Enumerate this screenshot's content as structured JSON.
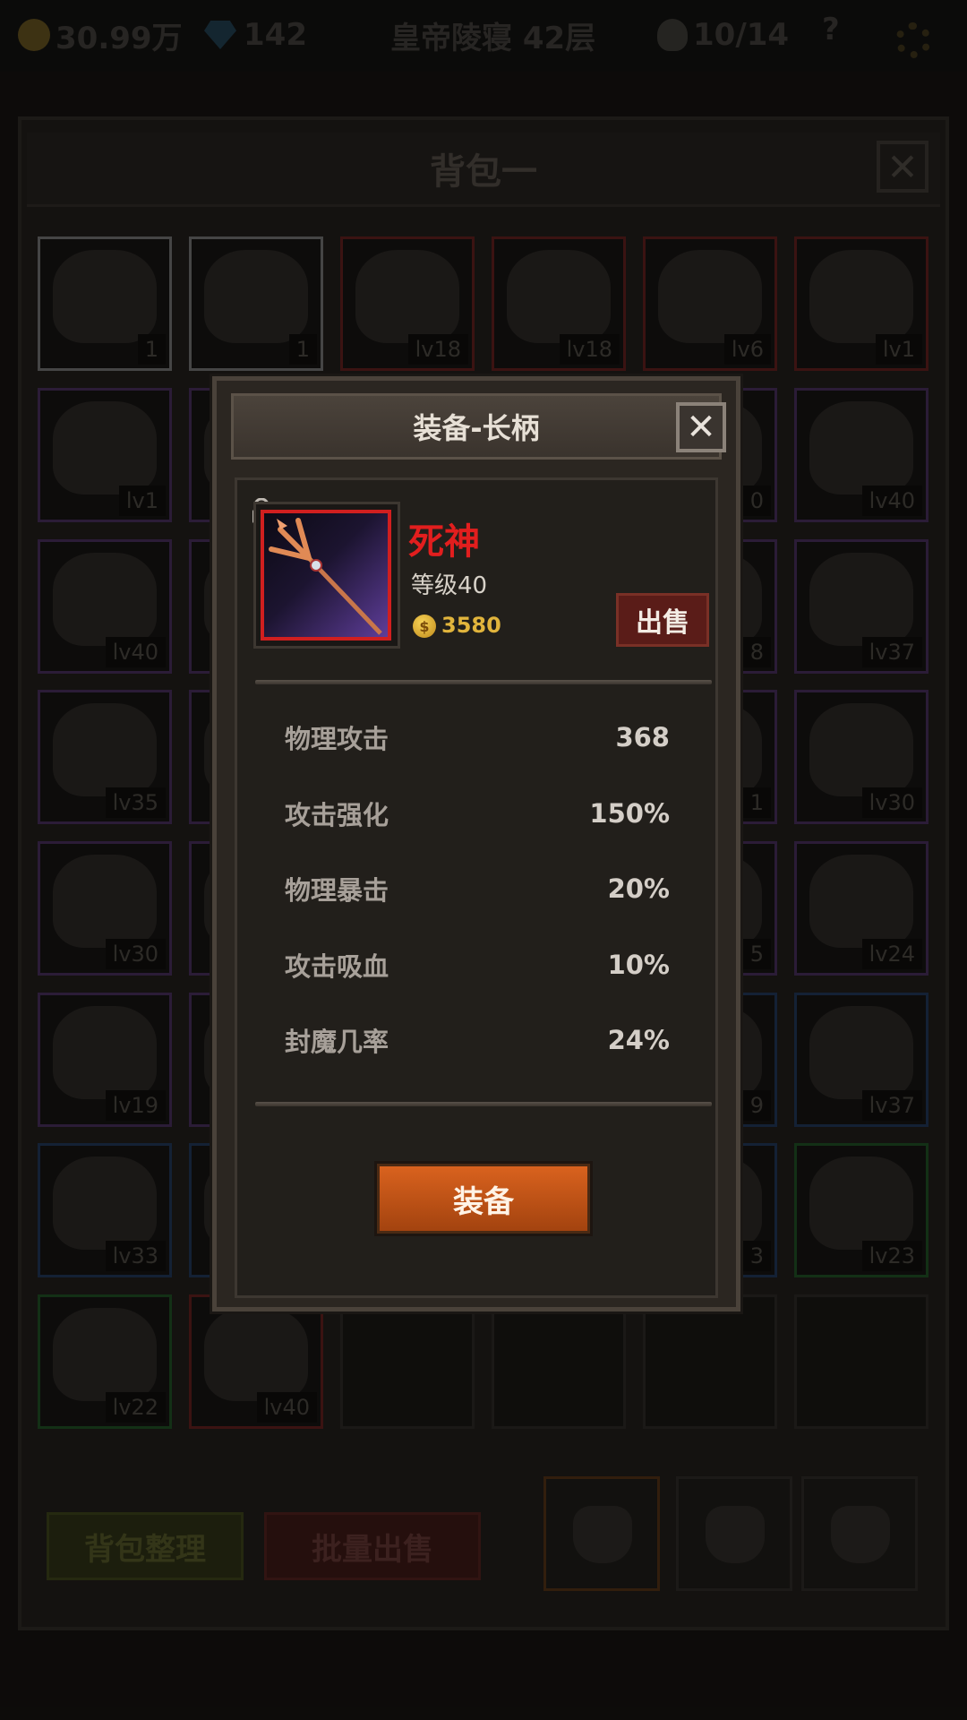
{
  "topbar": {
    "gold": "30.99万",
    "gems": "142",
    "location": "皇帝陵寝 42层",
    "kills": "10/14",
    "help": "?"
  },
  "bag": {
    "title": "背包一",
    "close": "✕",
    "slots": [
      {
        "label": "1",
        "rarity": "white"
      },
      {
        "label": "1",
        "rarity": "white"
      },
      {
        "label": "lv18",
        "rarity": "red"
      },
      {
        "label": "lv18",
        "rarity": "red"
      },
      {
        "label": "lv6",
        "rarity": "red"
      },
      {
        "label": "lv1",
        "rarity": "red"
      },
      {
        "label": "lv1",
        "rarity": "purple"
      },
      {
        "label": "",
        "rarity": "purple"
      },
      {
        "label": "",
        "rarity": "purple"
      },
      {
        "label": "",
        "rarity": "purple"
      },
      {
        "label": "0",
        "rarity": "purple"
      },
      {
        "label": "lv40",
        "rarity": "purple"
      },
      {
        "label": "lv40",
        "rarity": "purple"
      },
      {
        "label": "",
        "rarity": "purple"
      },
      {
        "label": "",
        "rarity": "purple"
      },
      {
        "label": "",
        "rarity": "purple"
      },
      {
        "label": "8",
        "rarity": "purple"
      },
      {
        "label": "lv37",
        "rarity": "purple"
      },
      {
        "label": "lv35",
        "rarity": "purple"
      },
      {
        "label": "",
        "rarity": "purple"
      },
      {
        "label": "",
        "rarity": "purple"
      },
      {
        "label": "",
        "rarity": "purple"
      },
      {
        "label": "1",
        "rarity": "purple"
      },
      {
        "label": "lv30",
        "rarity": "purple"
      },
      {
        "label": "lv30",
        "rarity": "purple"
      },
      {
        "label": "",
        "rarity": "purple"
      },
      {
        "label": "",
        "rarity": "purple"
      },
      {
        "label": "",
        "rarity": "purple"
      },
      {
        "label": "5",
        "rarity": "purple"
      },
      {
        "label": "lv24",
        "rarity": "purple"
      },
      {
        "label": "lv19",
        "rarity": "purple"
      },
      {
        "label": "",
        "rarity": "purple"
      },
      {
        "label": "",
        "rarity": "blue"
      },
      {
        "label": "",
        "rarity": "blue"
      },
      {
        "label": "9",
        "rarity": "blue"
      },
      {
        "label": "lv37",
        "rarity": "blue"
      },
      {
        "label": "lv33",
        "rarity": "blue"
      },
      {
        "label": "",
        "rarity": "blue"
      },
      {
        "label": "",
        "rarity": "blue"
      },
      {
        "label": "",
        "rarity": "blue"
      },
      {
        "label": "3",
        "rarity": "blue"
      },
      {
        "label": "lv23",
        "rarity": "green"
      },
      {
        "label": "lv22",
        "rarity": "green"
      },
      {
        "label": "lv40",
        "rarity": "red"
      },
      {
        "label": "",
        "rarity": "empty"
      },
      {
        "label": "",
        "rarity": "empty"
      },
      {
        "label": "",
        "rarity": "empty"
      },
      {
        "label": "",
        "rarity": "empty"
      }
    ],
    "tidy_button": "背包整理",
    "bulk_sell_button": "批量出售"
  },
  "modal": {
    "title": "装备-长柄",
    "close": "✕",
    "item": {
      "name": "死神",
      "level": "等级40",
      "price": "3580",
      "sell_button": "出售"
    },
    "stats": [
      {
        "label": "物理攻击",
        "value": "368"
      },
      {
        "label": "攻击强化",
        "value": "150%"
      },
      {
        "label": "物理暴击",
        "value": "20%"
      },
      {
        "label": "攻击吸血",
        "value": "10%"
      },
      {
        "label": "封魔几率",
        "value": "24%"
      }
    ],
    "equip_button": "装备"
  },
  "colors": {
    "item_name": "#e21e1e",
    "price": "#e1b43c",
    "equip_button": "#c75719",
    "sell_button": "#5a1c18"
  }
}
